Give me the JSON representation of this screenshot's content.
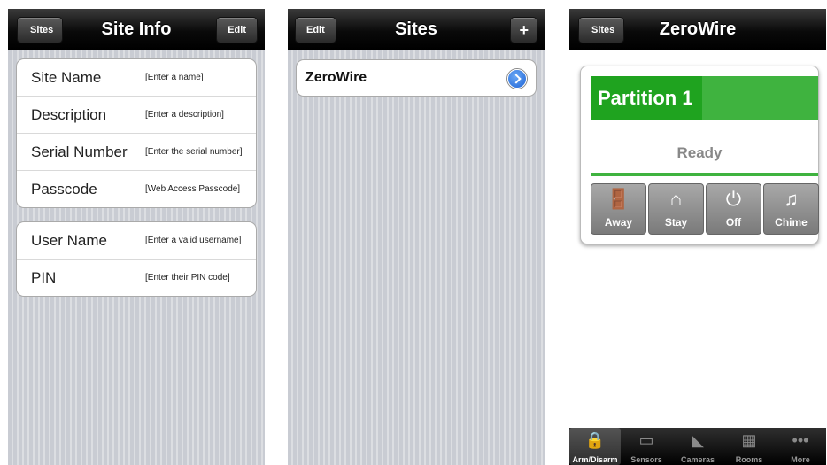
{
  "screen1": {
    "nav": {
      "back_label": "Sites",
      "title": "Site Info",
      "edit_label": "Edit"
    },
    "group1": [
      {
        "label": "Site Name",
        "placeholder": "[Enter a name]"
      },
      {
        "label": "Description",
        "placeholder": "[Enter a description]"
      },
      {
        "label": "Serial Number",
        "placeholder": "[Enter the serial number]"
      },
      {
        "label": "Passcode",
        "placeholder": "[Web Access Passcode]"
      }
    ],
    "group2": [
      {
        "label": "User Name",
        "placeholder": "[Enter a valid username]"
      },
      {
        "label": "PIN",
        "placeholder": "[Enter their PIN code]"
      }
    ]
  },
  "screen2": {
    "nav": {
      "edit_label": "Edit",
      "title": "Sites",
      "add_label": "+"
    },
    "site": {
      "name": "ZeroWire"
    }
  },
  "screen3": {
    "nav": {
      "back_label": "Sites",
      "title": "ZeroWire"
    },
    "partition": {
      "label": "Partition 1",
      "status": "Ready"
    },
    "buttons": [
      {
        "label": "Away",
        "icon": "door-exit-icon",
        "glyph": "🚪"
      },
      {
        "label": "Stay",
        "icon": "home-arm-icon",
        "glyph": "⌂"
      },
      {
        "label": "Off",
        "icon": "power-icon",
        "glyph": "⏻"
      },
      {
        "label": "Chime",
        "icon": "music-notes-icon",
        "glyph": "♫"
      }
    ],
    "tabs": [
      {
        "label": "Arm/Disarm",
        "icon": "padlock-icon",
        "glyph": "🔒",
        "active": true
      },
      {
        "label": "Sensors",
        "icon": "sensor-icon",
        "glyph": "▭",
        "active": false
      },
      {
        "label": "Cameras",
        "icon": "camera-icon",
        "glyph": "◣",
        "active": false
      },
      {
        "label": "Rooms",
        "icon": "rooms-icon",
        "glyph": "▦",
        "active": false
      },
      {
        "label": "More",
        "icon": "more-icon",
        "glyph": "•••",
        "active": false
      }
    ]
  },
  "colors": {
    "partition_green": "#3fb33f",
    "partition_label_green": "#1fa31f",
    "active_tab_blue": "#2d8bf0"
  }
}
